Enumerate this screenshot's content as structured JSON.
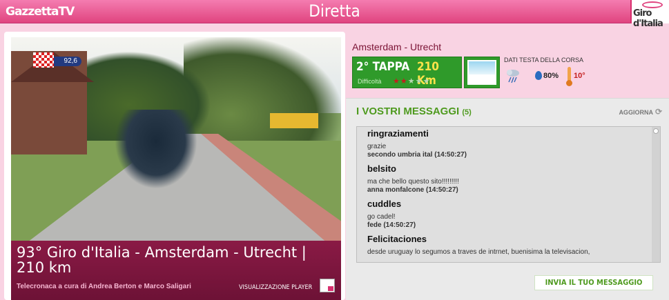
{
  "header": {
    "logo": "GazzettaTV",
    "title": "Diretta",
    "brand": "Giro d'Italia"
  },
  "video": {
    "overlay_speed": "92,6",
    "caption_title": "93° Giro d'Italia - Amsterdam - Utrecht | 210 km",
    "caption_sub": "Telecronaca a cura di Andrea Berton e Marco Saligari",
    "player_label": "VISUALIZZAZIONE PLAYER"
  },
  "stage": {
    "route": "Amsterdam - Utrecht",
    "label": "2° TAPPA",
    "km": "210 Km",
    "difficulty_label": "Difficoltà",
    "difficulty_stars": 2,
    "difficulty_max": 5
  },
  "weather": {
    "title": "DATI TESTA DELLA CORSA",
    "humidity": "80%",
    "temperature": "10°"
  },
  "messages": {
    "header": "I VOSTRI MESSAGGI",
    "count": "(5)",
    "refresh_label": "AGGIORNA",
    "items": [
      {
        "author": "ringraziamenti",
        "text": "grazie",
        "meta": "secondo umbria ital  (14:50:27)"
      },
      {
        "author": "belsito",
        "text": "ma che bello questo sito!!!!!!!!!",
        "meta": "anna monfalcone  (14:50:27)"
      },
      {
        "author": "cuddles",
        "text": "go cadel!",
        "meta": "fede  (14:50:27)"
      },
      {
        "author": "Felicitaciones",
        "text": "desde uruguay lo segumos a traves de intrnet, buenisima la televisacion,",
        "meta": ""
      }
    ],
    "send_label": "INVIA IL TUO MESSAGGIO"
  },
  "colors": {
    "header_pink": "#e0447f",
    "caption_maroon": "#7a1234",
    "stage_green": "#2f9a2a",
    "message_green": "#4e9a1e"
  }
}
